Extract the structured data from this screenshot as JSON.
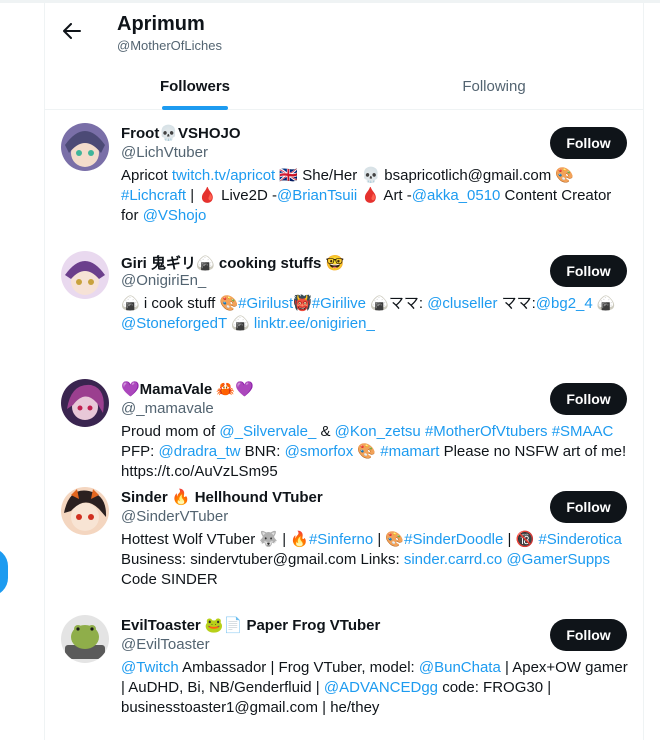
{
  "header": {
    "title": "Aprimum",
    "handle": "@MotherOfLiches",
    "tabs": [
      {
        "label": "Followers",
        "active": true
      },
      {
        "label": "Following",
        "active": false
      }
    ]
  },
  "colors": {
    "accent": "#1d9bf0",
    "text": "#0f1419",
    "muted": "#536471",
    "button": "#0f1419"
  },
  "users": [
    {
      "name": "Froot💀VSHOJO",
      "handle": "@LichVtuber",
      "button": "Follow",
      "bio": [
        {
          "t": "Apricot "
        },
        {
          "t": "twitch.tv/apricot",
          "link": true
        },
        {
          "t": " 🇬🇧 She/Her 💀 bsapricotlich@gmail.com 🎨 "
        },
        {
          "t": "#Lichcraft",
          "link": true
        },
        {
          "t": " | 🩸 Live2D -"
        },
        {
          "t": "@BrianTsuii",
          "link": true
        },
        {
          "t": " 🩸 Art -"
        },
        {
          "t": "@akka_0510",
          "link": true
        },
        {
          "t": " Content Creator for "
        },
        {
          "t": "@VShojo",
          "link": true
        }
      ]
    },
    {
      "name": "Giri 鬼ギリ🍙 cooking stuffs 🤓",
      "handle": "@OnigiriEn_",
      "button": "Follow",
      "bio": [
        {
          "t": "🍙 i cook stuff 🎨"
        },
        {
          "t": "#Girilust",
          "link": true
        },
        {
          "t": "👹"
        },
        {
          "t": "#Girilive",
          "link": true
        },
        {
          "t": " 🍙ママ: "
        },
        {
          "t": "@cluseller",
          "link": true
        },
        {
          "t": " ママ:"
        },
        {
          "t": "@bg2_4",
          "link": true
        },
        {
          "t": " 🍙 "
        },
        {
          "t": "@StoneforgedT",
          "link": true
        },
        {
          "t": " 🍙 "
        },
        {
          "t": "linktr.ee/onigirien_",
          "link": true
        }
      ]
    },
    {
      "name": "💜MamaVale 🦀💜",
      "handle": "@_mamavale",
      "button": "Follow",
      "bio": [
        {
          "t": "Proud mom of "
        },
        {
          "t": "@_Silvervale_",
          "link": true
        },
        {
          "t": " & "
        },
        {
          "t": "@Kon_zetsu",
          "link": true
        },
        {
          "t": " "
        },
        {
          "t": "#MotherOfVtubers",
          "link": true
        },
        {
          "t": " "
        },
        {
          "t": "#SMAAC",
          "link": true
        },
        {
          "t": " PFP: "
        },
        {
          "t": "@dradra_tw",
          "link": true
        },
        {
          "t": " BNR: "
        },
        {
          "t": "@smorfox",
          "link": true
        },
        {
          "t": " 🎨 "
        },
        {
          "t": "#mamart",
          "link": true
        },
        {
          "t": " Please no NSFW art of me! https://t.co/AuVzLSm95"
        }
      ]
    },
    {
      "name": "Sinder 🔥 Hellhound VTuber",
      "handle": "@SinderVTuber",
      "button": "Follow",
      "bio": [
        {
          "t": "Hottest Wolf VTuber 🐺 | 🔥"
        },
        {
          "t": "#Sinferno",
          "link": true
        },
        {
          "t": " | 🎨"
        },
        {
          "t": "#SinderDoodle",
          "link": true
        },
        {
          "t": " | 🔞 "
        },
        {
          "t": "#Sinderotica",
          "link": true
        },
        {
          "t": " Business: sindervtuber@gmail.com Links: "
        },
        {
          "t": "sinder.carrd.co",
          "link": true
        },
        {
          "t": " "
        },
        {
          "t": "@GamerSupps",
          "link": true
        },
        {
          "t": " Code SINDER"
        }
      ]
    },
    {
      "name": "EvilToaster 🐸📄 Paper Frog VTuber",
      "handle": "@EvilToaster",
      "button": "Follow",
      "bio": [
        {
          "t": "@Twitch",
          "link": true
        },
        {
          "t": " Ambassador | Frog VTuber, model: "
        },
        {
          "t": "@BunChata",
          "link": true
        },
        {
          "t": " | Apex+OW gamer | AuDHD, Bi, NB/Genderfluid | "
        },
        {
          "t": "@ADVANCEDgg",
          "link": true
        },
        {
          "t": " code: FROG30 | businesstoaster1@gmail.com | he/they"
        }
      ]
    }
  ]
}
